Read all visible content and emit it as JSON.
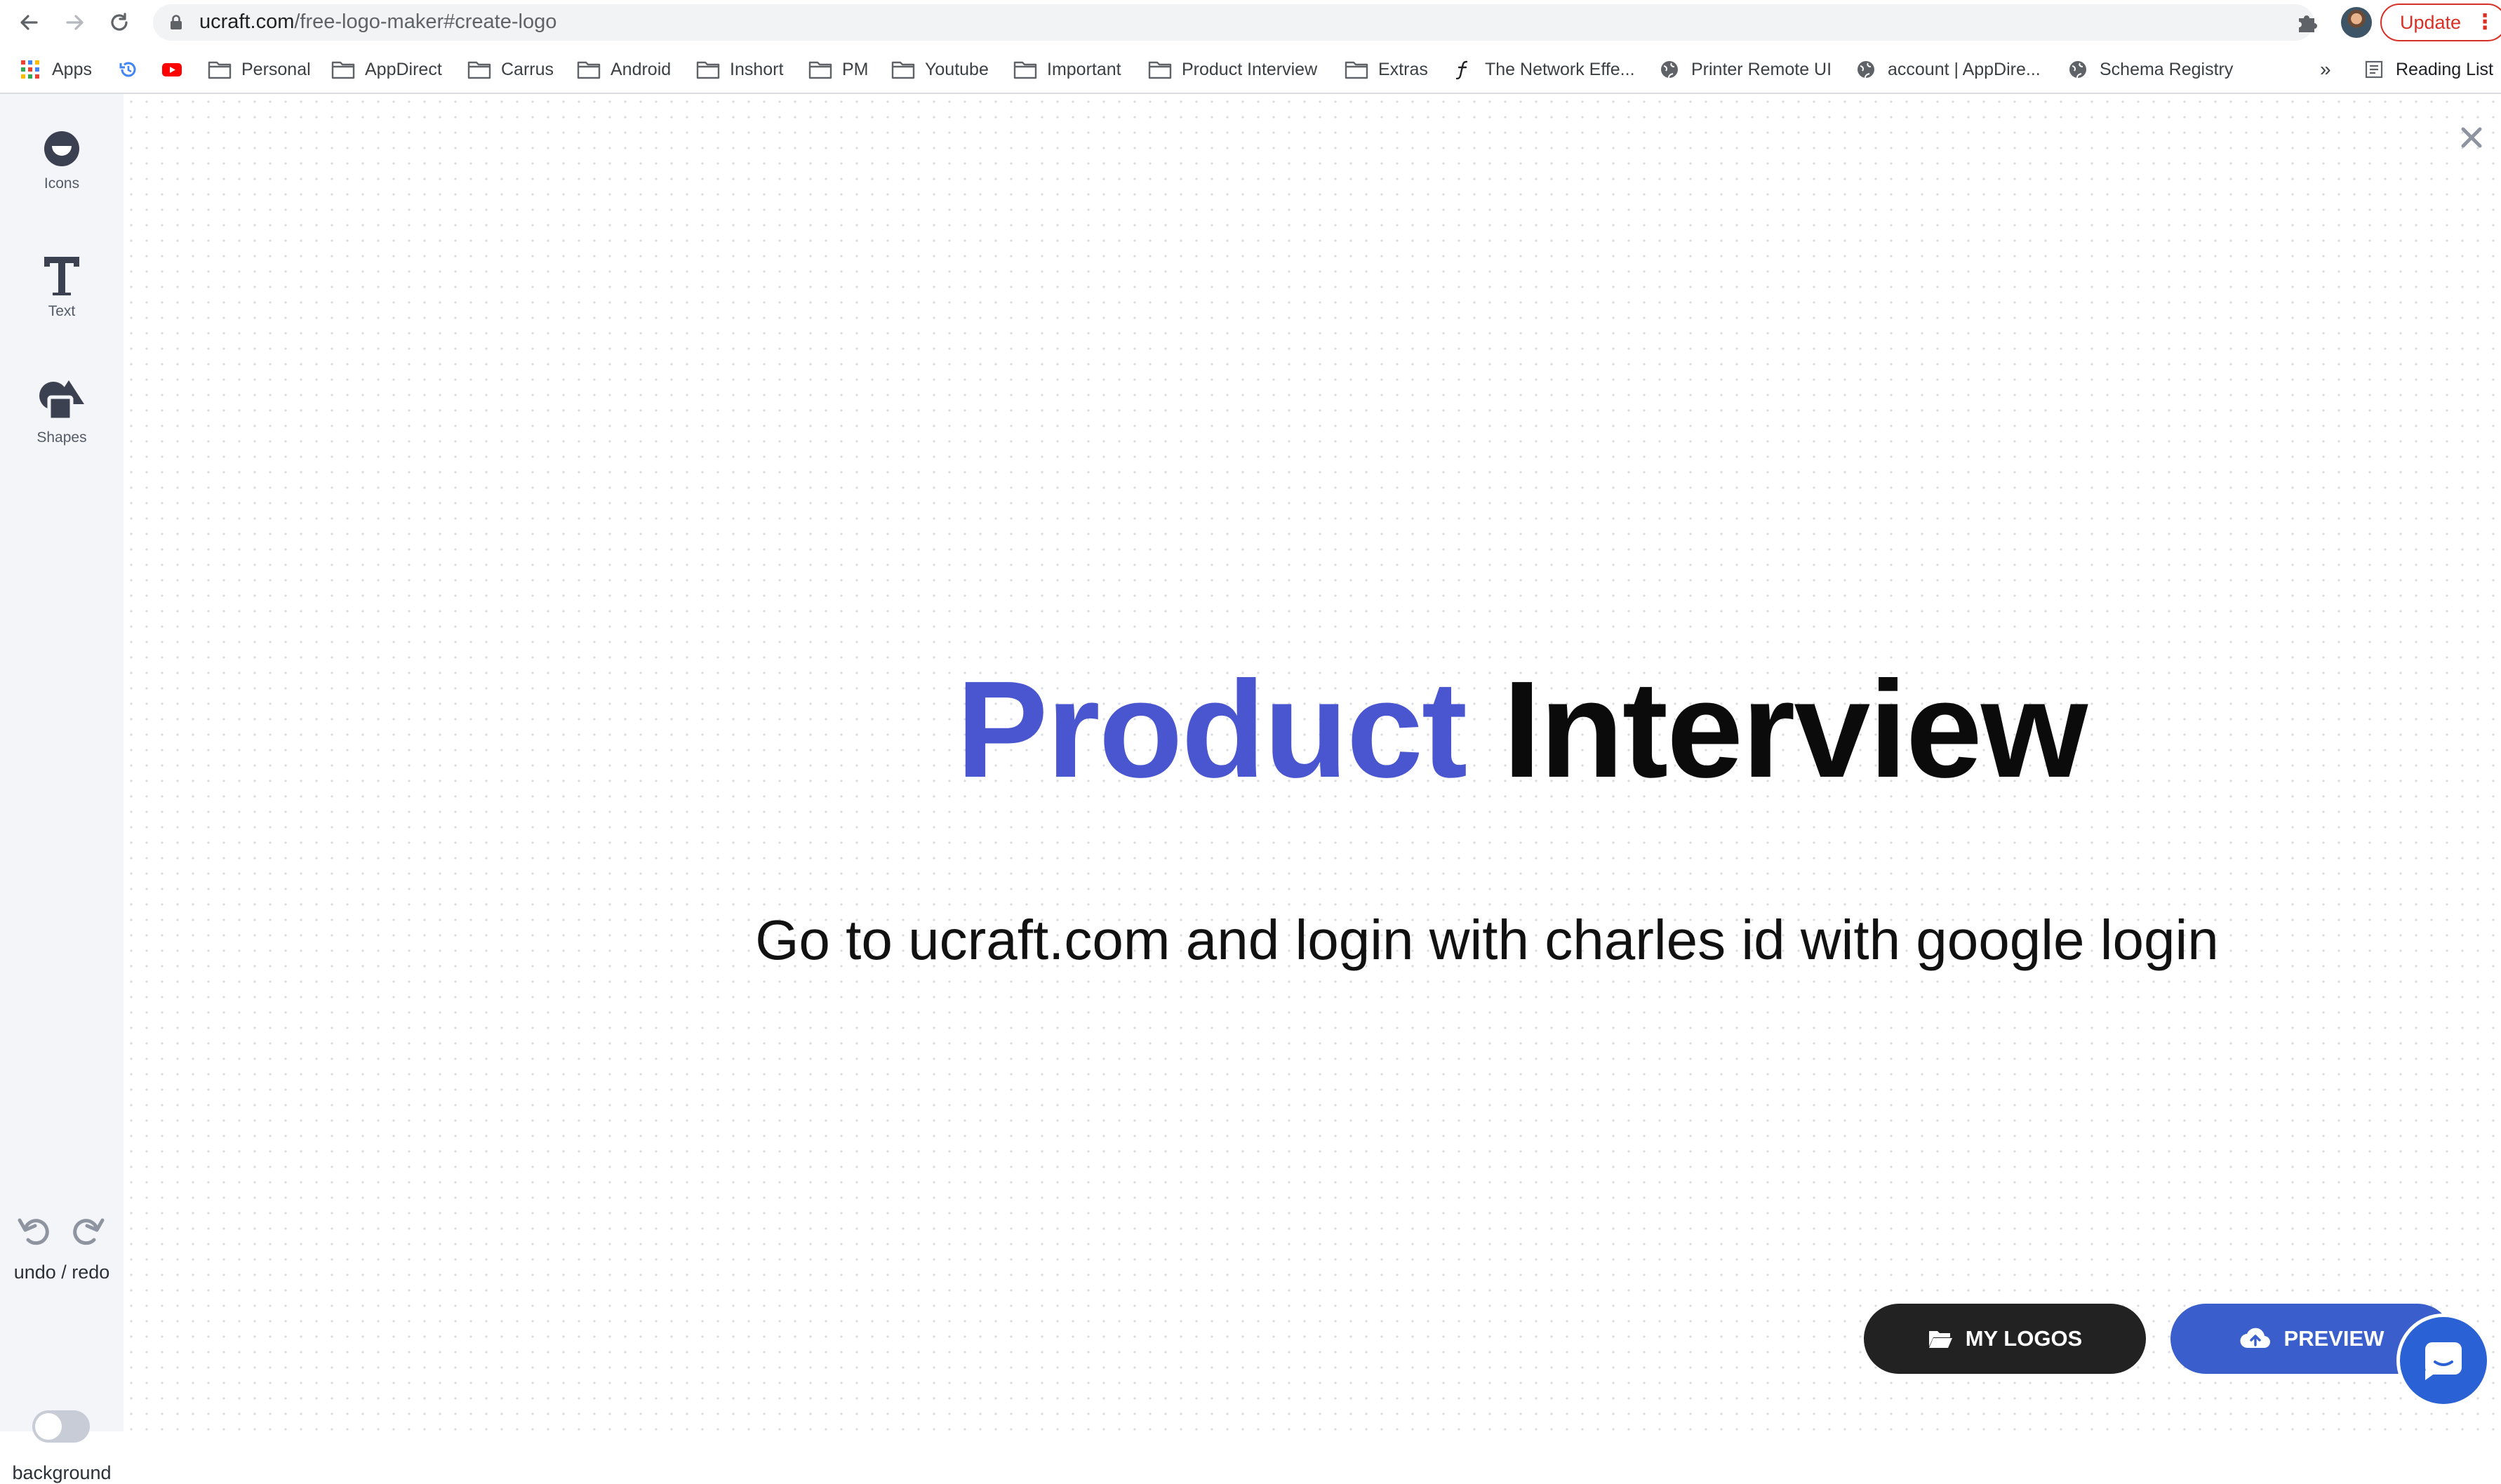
{
  "browser": {
    "url_host": "ucraft.com",
    "url_path": "/free-logo-maker#create-logo",
    "update_label": "Update",
    "bookmarks": [
      {
        "label": "Apps",
        "icon": "apps-grid-icon"
      },
      {
        "label": "",
        "icon": "history-icon"
      },
      {
        "label": "",
        "icon": "youtube-icon"
      },
      {
        "label": "Personal",
        "icon": "folder-icon"
      },
      {
        "label": "AppDirect",
        "icon": "folder-icon"
      },
      {
        "label": "Carrus",
        "icon": "folder-icon"
      },
      {
        "label": "Android",
        "icon": "folder-icon"
      },
      {
        "label": "Inshort",
        "icon": "folder-icon"
      },
      {
        "label": "PM",
        "icon": "folder-icon"
      },
      {
        "label": "Youtube",
        "icon": "folder-icon"
      },
      {
        "label": "Important",
        "icon": "folder-icon"
      },
      {
        "label": "Product Interview",
        "icon": "folder-icon"
      },
      {
        "label": "Extras",
        "icon": "folder-icon"
      },
      {
        "label": "The Network Effe...",
        "icon": "function-icon"
      },
      {
        "label": "Printer Remote UI",
        "icon": "globe-icon"
      },
      {
        "label": "account | AppDire...",
        "icon": "globe-icon"
      },
      {
        "label": "Schema Registry",
        "icon": "globe-icon"
      }
    ],
    "overflow_label": "»",
    "reading_list_label": "Reading List"
  },
  "sidebar": {
    "tools": [
      {
        "label": "Icons",
        "icon": "icons-icon"
      },
      {
        "label": "Text",
        "icon": "text-icon"
      },
      {
        "label": "Shapes",
        "icon": "shapes-icon"
      }
    ],
    "undo_redo_label": "undo / redo",
    "background_label": "background"
  },
  "canvas": {
    "logo_word1": "Product",
    "logo_word2": "Interview",
    "slogan": "Go to ucraft.com and login with charles id with google login"
  },
  "actions": {
    "my_logos_label": "MY LOGOS",
    "preview_label": "PREVIEW"
  },
  "colors": {
    "logo_word1": "#4a56d0",
    "logo_word2": "#0b0b0b",
    "preview_button": "#3a5fcd",
    "my_logos_button": "#222222",
    "update_accent": "#d93025"
  }
}
